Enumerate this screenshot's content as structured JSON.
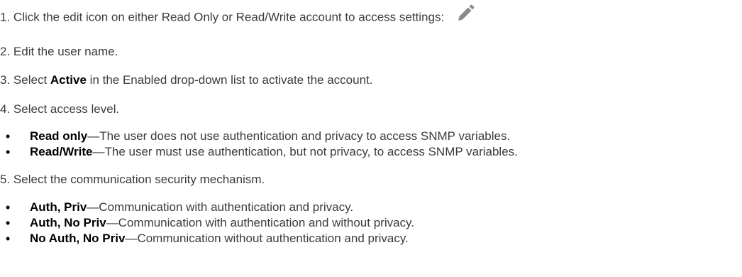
{
  "steps": [
    {
      "number": "1.",
      "text": "Click the edit icon on either Read Only or Read/Write account to access settings:",
      "icon": "pencil-icon"
    },
    {
      "number": "2.",
      "text": "Edit the user name."
    },
    {
      "number": "3.",
      "prefix": "Select ",
      "bold": "Active",
      "suffix": " in the Enabled drop-down list to activate the account."
    },
    {
      "number": "4.",
      "text": "Select access level.",
      "bullets": [
        {
          "bold": "Read only",
          "text": "—The user does not use authentication and privacy to access SNMP variables."
        },
        {
          "bold": "Read/Write",
          "text": "—The user must use authentication, but not privacy, to access SNMP variables."
        }
      ]
    },
    {
      "number": "5.",
      "text": "Select the communication security mechanism.",
      "bullets": [
        {
          "bold": "Auth, Priv",
          "text": "—Communication with authentication and privacy."
        },
        {
          "bold": "Auth, No Priv",
          "text": "—Communication with authentication and without privacy."
        },
        {
          "bold": "No Auth, No Priv",
          "text": "—Communication without authentication and privacy."
        }
      ]
    }
  ],
  "colors": {
    "text": "#3b3b3b",
    "bold": "#000000",
    "icon": "#8a8a8a"
  }
}
